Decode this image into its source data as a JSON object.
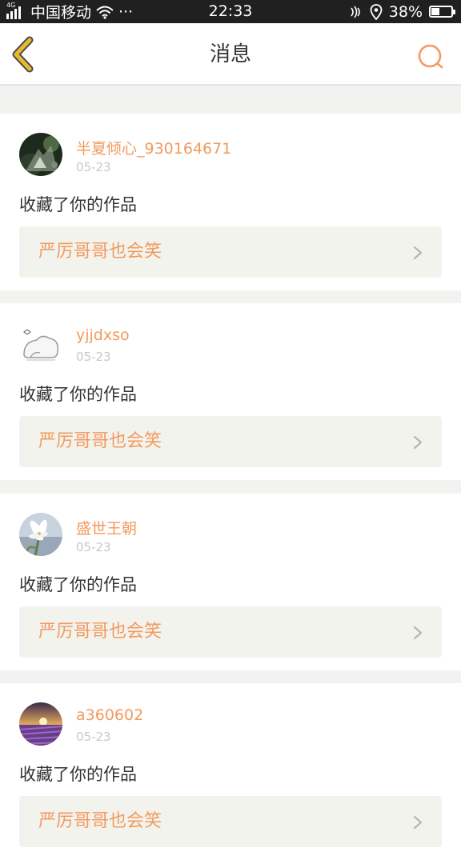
{
  "status_bar": {
    "network_label": "4G",
    "carrier": "中国移动",
    "more": "···",
    "time": "22:33",
    "battery_percent_text": "38%",
    "battery_level": 0.38,
    "icons": [
      "signal-icon",
      "wifi-icon",
      "nfc-icon",
      "location-icon",
      "battery-icon"
    ]
  },
  "nav": {
    "title": "消息",
    "back_icon": "chevron-left-icon",
    "search_icon": "search-icon",
    "accent_color": "#f29a5e",
    "back_color": "#e8b930"
  },
  "notifications": [
    {
      "username": "半夏倾心_930164671",
      "date": "05-23",
      "action": "收藏了你的作品",
      "work_title": "严厉哥哥也会笑",
      "avatar": "photo-avatar-dark-green"
    },
    {
      "username": "yjjdxso",
      "date": "05-23",
      "action": "收藏了你的作品",
      "work_title": "严厉哥哥也会笑",
      "avatar": "sketch-avatar"
    },
    {
      "username": "盛世王朝",
      "date": "05-23",
      "action": "收藏了你的作品",
      "work_title": "严厉哥哥也会笑",
      "avatar": "lily-flower-avatar"
    },
    {
      "username": "a360602",
      "date": "05-23",
      "action": "收藏了你的作品",
      "work_title": "严厉哥哥也会笑",
      "avatar": "lavender-field-avatar"
    }
  ]
}
